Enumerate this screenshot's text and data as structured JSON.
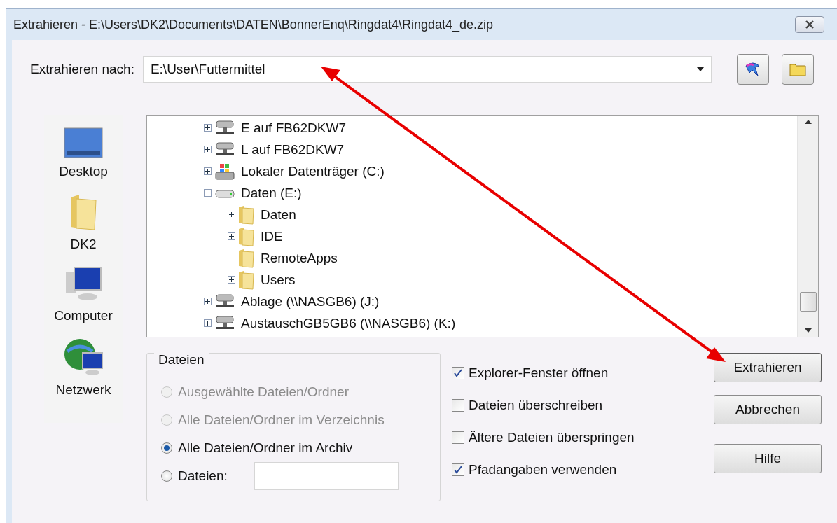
{
  "window": {
    "title": "Extrahieren - E:\\Users\\DK2\\Documents\\DATEN\\BonnerEnq\\Ringdat4\\Ringdat4_de.zip"
  },
  "destination": {
    "label": "Extrahieren nach:",
    "value": "E:\\User\\Futtermittel"
  },
  "places": [
    {
      "label": "Desktop",
      "kind": "desktop"
    },
    {
      "label": "DK2",
      "kind": "folder"
    },
    {
      "label": "Computer",
      "kind": "computer"
    },
    {
      "label": "Netzwerk",
      "kind": "network"
    }
  ],
  "tree": [
    {
      "label": "E auf FB62DKW7",
      "kind": "netdrive",
      "expanded": false
    },
    {
      "label": "L auf FB62DKW7",
      "kind": "netdrive",
      "expanded": false
    },
    {
      "label": "Lokaler Datenträger (C:)",
      "kind": "sysdrive",
      "expanded": false
    },
    {
      "label": "Daten (E:)",
      "kind": "drive",
      "expanded": true,
      "children": [
        {
          "label": "Daten",
          "kind": "folder",
          "expanded": false
        },
        {
          "label": "IDE",
          "kind": "folder",
          "expanded": false
        },
        {
          "label": "RemoteApps",
          "kind": "folder"
        },
        {
          "label": "Users",
          "kind": "folder",
          "expanded": false
        }
      ]
    },
    {
      "label": "Ablage (\\\\NASGB6) (J:)",
      "kind": "netdrive",
      "expanded": false
    },
    {
      "label": "AustauschGB5GB6 (\\\\NASGB6) (K:)",
      "kind": "netdrive",
      "expanded": false
    }
  ],
  "files_group": {
    "title": "Dateien",
    "options": [
      {
        "label": "Ausgewählte Dateien/Ordner",
        "selected": false,
        "disabled": true
      },
      {
        "label": "Alle Dateien/Ordner im Verzeichnis",
        "selected": false,
        "disabled": true
      },
      {
        "label": "Alle Dateien/Ordner im Archiv",
        "selected": true,
        "disabled": false
      },
      {
        "label": "Dateien:",
        "selected": false,
        "disabled": false,
        "kind": "field"
      }
    ]
  },
  "options": [
    {
      "label": "Explorer-Fenster öffnen",
      "checked": true
    },
    {
      "label": "Dateien überschreiben",
      "checked": false
    },
    {
      "label": "Ältere Dateien überspringen",
      "checked": false
    },
    {
      "label": "Pfadangaben verwenden",
      "checked": true
    }
  ],
  "buttons": [
    {
      "label": "Extrahieren",
      "default": true
    },
    {
      "label": "Abbrechen",
      "default": false
    },
    {
      "label": "Hilfe",
      "default": false
    }
  ]
}
